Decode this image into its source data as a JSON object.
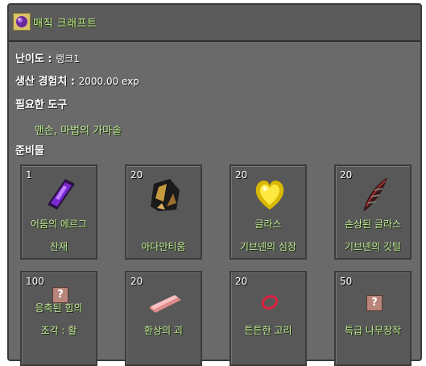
{
  "window": {
    "title": "매직 크래프트",
    "icon": "magic-orb-icon"
  },
  "info": {
    "difficulty_label": "난이도 :",
    "difficulty_value": "랭크1",
    "exp_label": "생산 경험치 :",
    "exp_value": "2000.00 exp",
    "tools_heading": "필요한 도구",
    "tools_value": "맨손, 마법의 가마솥",
    "materials_heading": "준비물"
  },
  "materials": [
    {
      "qty": "1",
      "line1": "어둠의 에르그",
      "line2": "잔재",
      "icon": "dark-erg-crystal-icon"
    },
    {
      "qty": "20",
      "line1": "",
      "line2": "아다만티움",
      "icon": "adamantium-ore-icon"
    },
    {
      "qty": "20",
      "line1": "글라스",
      "line2": "기브넨의 심장",
      "icon": "golden-heart-icon"
    },
    {
      "qty": "20",
      "line1": "손상된 글라스",
      "line2": "기브넨의 깃털",
      "icon": "dark-feather-icon"
    },
    {
      "qty": "100",
      "line1": "응축된 힘의",
      "line2": "조각 : 활",
      "icon": "unknown-item-icon"
    },
    {
      "qty": "20",
      "line1": "",
      "line2": "환상의 괴",
      "icon": "fantasy-ingot-icon"
    },
    {
      "qty": "20",
      "line1": "",
      "line2": "튼튼한 고리",
      "icon": "red-ring-icon"
    },
    {
      "qty": "50",
      "line1": "",
      "line2": "특급 나무장작",
      "icon": "unknown-item-icon"
    }
  ]
}
